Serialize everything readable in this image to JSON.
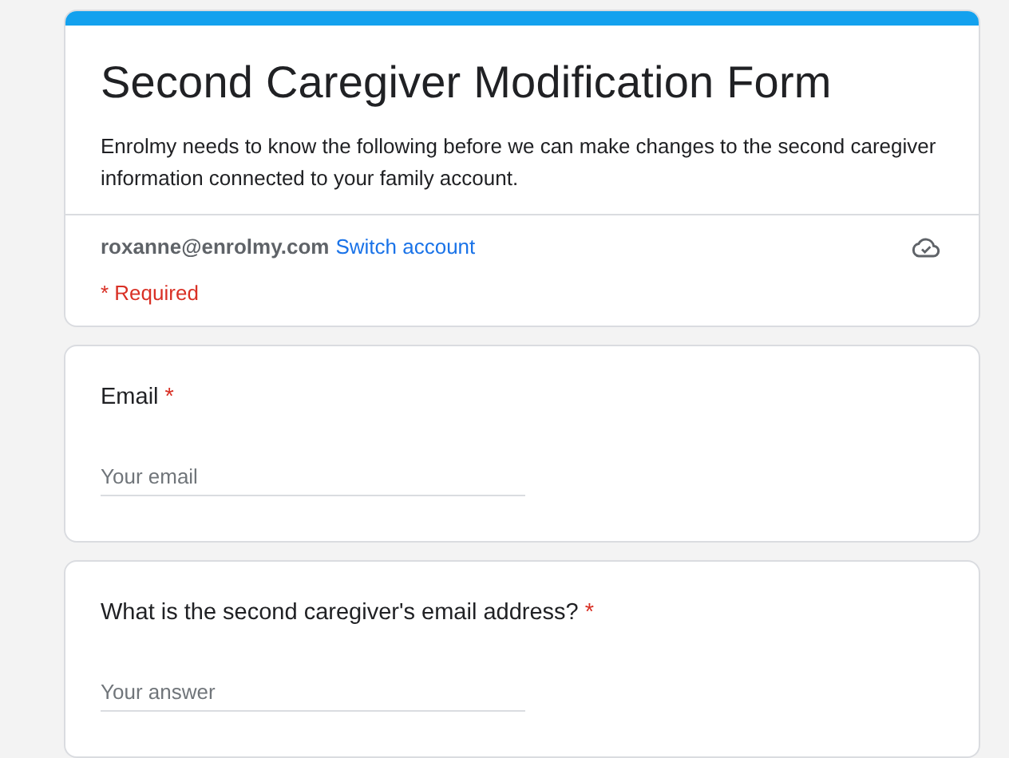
{
  "header": {
    "title": "Second Caregiver Modification Form",
    "description": "Enrolmy needs to know the following before we can make changes to the second caregiver information connected to your family account.",
    "account_email": "roxanne@enrolmy.com",
    "switch_account": "Switch account",
    "saved": true,
    "required_note": "* Required"
  },
  "questions": [
    {
      "label": "Email",
      "required_mark": "*",
      "placeholder": "Your email"
    },
    {
      "label": "What is the second caregiver's email address?",
      "required_mark": "*",
      "placeholder": "Your answer"
    }
  ]
}
